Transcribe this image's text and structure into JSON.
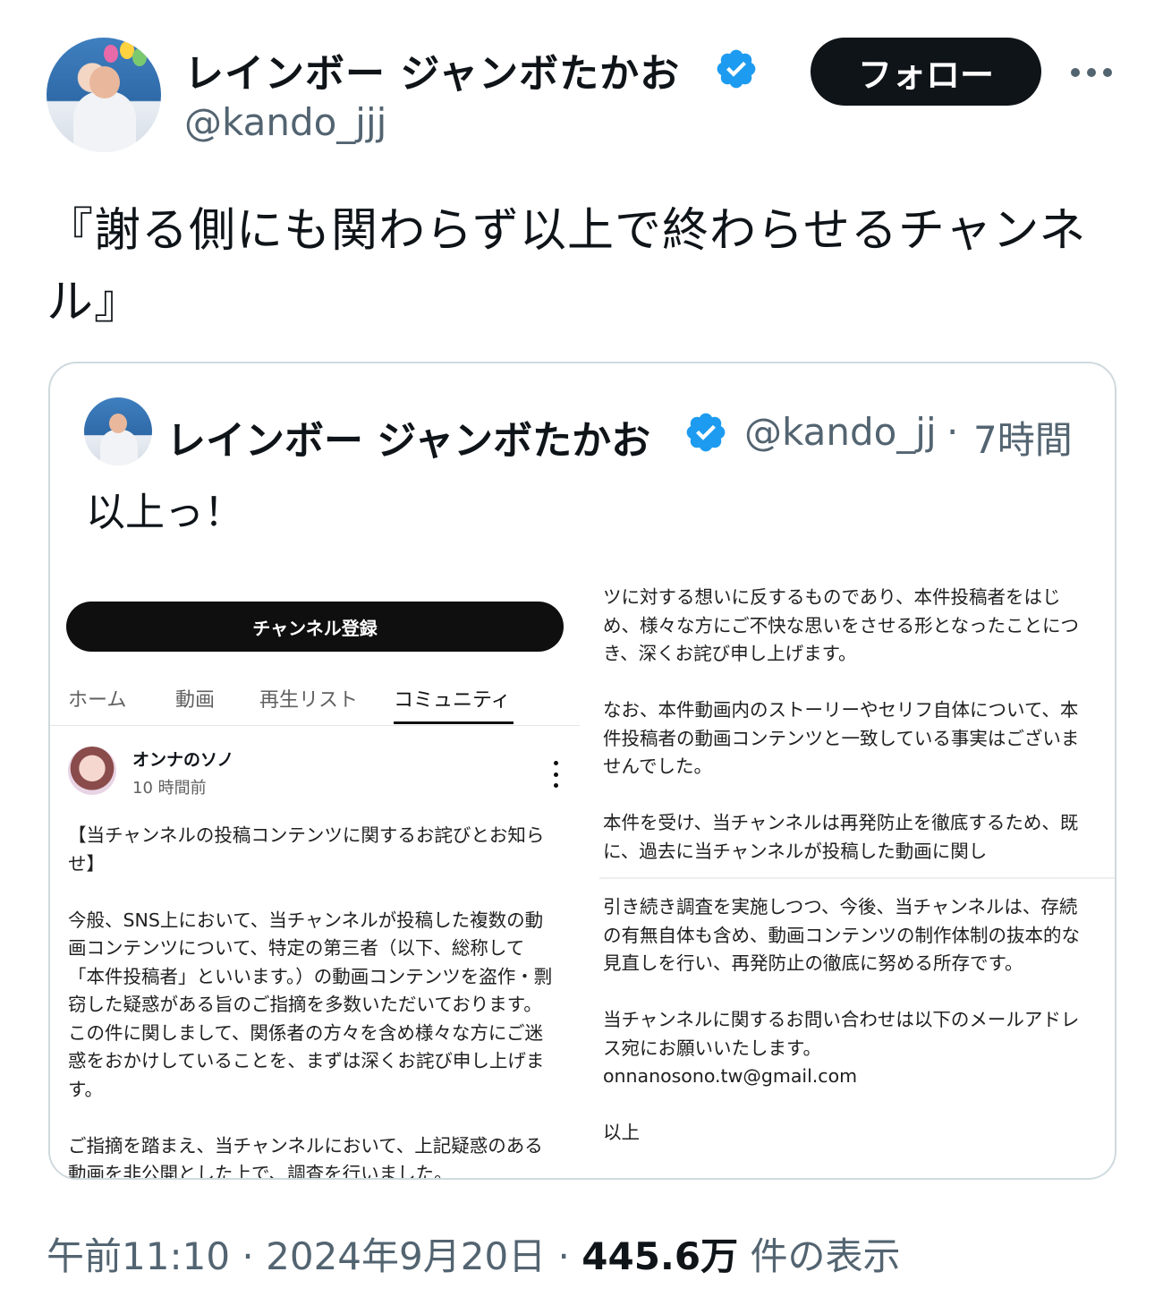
{
  "tweet": {
    "author": {
      "display_name": "レインボー ジャンボたかお",
      "handle": "@kando_jjj",
      "verified": true
    },
    "follow_label": "フォロー",
    "text": "『謝る側にも関わらず以上で終わらせるチャンネル』",
    "quoted": {
      "display_name": "レインボー ジャンボたかお",
      "handle": "@kando_jj",
      "separator": "·",
      "time": "7時間",
      "text": "以上っ！",
      "image": {
        "left": {
          "subscribe_label": "チャンネル登録",
          "tabs": [
            {
              "label": "ホーム",
              "active": false
            },
            {
              "label": "動画",
              "active": false
            },
            {
              "label": "再生リスト",
              "active": false
            },
            {
              "label": "コミュニティ",
              "active": true
            }
          ],
          "post": {
            "author": "オンナのソノ",
            "time": "10 時間前",
            "paragraphs": [
              "【当チャンネルの投稿コンテンツに関するお詫びとお知らせ】",
              "今般、SNS上において、当チャンネルが投稿した複数の動画コンテンツについて、特定の第三者（以下、総称して「本件投稿者」といいます。）の動画コンテンツを盗作・剽窃した疑惑がある旨のご指摘を多数いただいております。この件に関しまして、関係者の方々を含め様々な方にご迷惑をおかけしていることを、まずは深くお詫び申し上げます。",
              "ご指摘を踏まえ、当チャンネルにおいて、上記疑惑のある動画を非公開とした上で、調査を行いました。"
            ]
          }
        },
        "right": {
          "top_paragraphs": [
            "ツに対する想いに反するものであり、本件投稿者をはじめ、様々な方にご不快な思いをさせる形となったことにつき、深くお詫び申し上げます。",
            "なお、本件動画内のストーリーやセリフ自体について、本件投稿者の動画コンテンツと一致している事実はございませんでした。",
            "本件を受け、当チャンネルは再発防止を徹底するため、既に、過去に当チャンネルが投稿した動画に関し"
          ],
          "bottom_paragraphs": [
            "引き続き調査を実施しつつ、今後、当チャンネルは、存続の有無自体も含め、動画コンテンツの制作体制の抜本的な見直しを行い、再発防止の徹底に努める所存です。",
            "当チャンネルに関するお問い合わせは以下のメールアドレス宛にお願いいたします。",
            "以上"
          ],
          "email": "onnanosono.tw@gmail.com"
        }
      }
    },
    "meta": {
      "time": "午前11:10",
      "sep1": "·",
      "date": "2024年9月20日",
      "sep2": "·",
      "views": "445.6万",
      "views_suffix": "件の表示"
    }
  },
  "colors": {
    "text_primary": "#0f1419",
    "text_secondary": "#536471",
    "verified_blue": "#1d9bf0",
    "border": "#cfd9de"
  }
}
